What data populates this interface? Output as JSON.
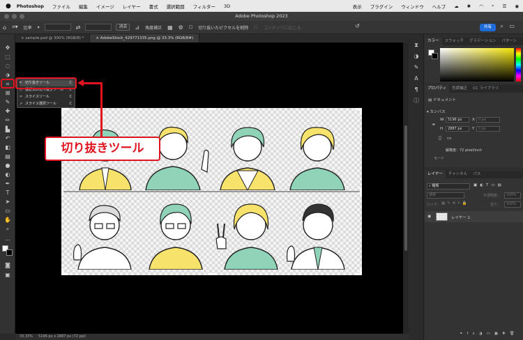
{
  "menubar": {
    "apple": "",
    "app": "Photoshop",
    "items": [
      "ファイル",
      "編集",
      "イメージ",
      "レイヤー",
      "書式",
      "選択範囲",
      "フィルター",
      "3D",
      "表示",
      "プラグイン",
      "ウィンドウ",
      "ヘルプ"
    ]
  },
  "window": {
    "title": "Adobe Photoshop 2023"
  },
  "options": {
    "ratio": "比率",
    "clear": "消去",
    "straighten": "角度補正",
    "delete_pixels": "切り抜いたピクセルを削除",
    "content_aware": "コンテンツに応じる",
    "share": "共有"
  },
  "tabs": [
    {
      "label": "sample.psd @ 300% (RGB/8) *"
    },
    {
      "label": "AdobeStock_429771335.png @ 33.3% (RGB/8#)"
    }
  ],
  "flyout": {
    "items": [
      {
        "label": "切り抜きツール",
        "key": "C"
      },
      {
        "label": "遠近法の切り抜きツール",
        "key": "C"
      },
      {
        "label": "スライスツール",
        "key": "C"
      },
      {
        "label": "スライス選択ツール",
        "key": "C"
      }
    ]
  },
  "callout": {
    "text": "切り抜きツール"
  },
  "status": {
    "zoom": "33.33%",
    "info": "5196 px x 2887 px (72 ppi)"
  },
  "panels": {
    "color_tabs": [
      "カラー",
      "スウォッチ",
      "グラデーション",
      "パターン"
    ],
    "properties_tabs": [
      "プロパティ",
      "色調補正",
      "CC ライブラリ"
    ],
    "document": "ドキュメント",
    "canvas": "カンバス",
    "w_label": "W",
    "w_value": "5196 px",
    "x_label": "X",
    "x_value": "0 px",
    "h_label": "H",
    "h_value": "2887 px",
    "y_label": "Y",
    "y_value": "0 px",
    "resolution": "解像度：72 pixel/inch",
    "mode": "モード",
    "layers_tabs": [
      "レイヤー",
      "チャンネル",
      "パス"
    ],
    "kind": "種類",
    "blend": "通常",
    "opacity_label": "不透明度：",
    "opacity": "100%",
    "lock_label": "ロック：",
    "fill_label": "塗り：",
    "fill": "100%",
    "layer_name": "レイヤー 1"
  },
  "colors": {
    "highlight": "#e0141e",
    "yellow": "#f7e26b",
    "mint": "#8fd3b8",
    "share": "#1f6bd8"
  }
}
